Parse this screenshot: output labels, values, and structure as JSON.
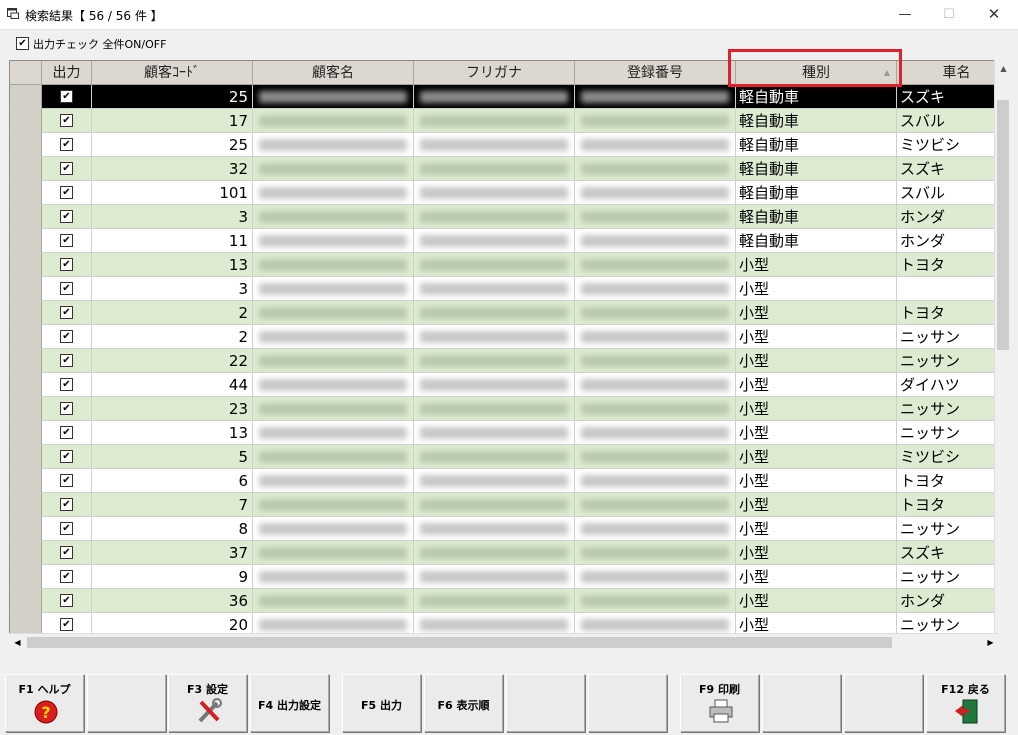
{
  "window": {
    "title": "検索結果【 56 / 56 件 】",
    "minimize": "—",
    "maximize": "☐",
    "close": "✕"
  },
  "select_all": {
    "label": "出力チェック 全件ON/OFF",
    "checked": true
  },
  "grid": {
    "columns": [
      "",
      "出力",
      "顧客ｺｰﾄﾞ",
      "顧客名",
      "フリガナ",
      "登録番号",
      "種別",
      "車名"
    ],
    "sorted_column": "種別",
    "sort_indicator": "▲",
    "rows": [
      {
        "check": "✔",
        "code": "25",
        "type": "軽自動車",
        "maker": "スズキ",
        "selected": true
      },
      {
        "check": "✔",
        "code": "17",
        "type": "軽自動車",
        "maker": "スバル"
      },
      {
        "check": "✔",
        "code": "25",
        "type": "軽自動車",
        "maker": "ミツビシ"
      },
      {
        "check": "✔",
        "code": "32",
        "type": "軽自動車",
        "maker": "スズキ"
      },
      {
        "check": "✔",
        "code": "101",
        "type": "軽自動車",
        "maker": "スバル"
      },
      {
        "check": "✔",
        "code": "3",
        "type": "軽自動車",
        "maker": "ホンダ"
      },
      {
        "check": "✔",
        "code": "11",
        "type": "軽自動車",
        "maker": "ホンダ"
      },
      {
        "check": "✔",
        "code": "13",
        "type": "小型",
        "maker": "トヨタ"
      },
      {
        "check": "✔",
        "code": "3",
        "type": "小型",
        "maker": ""
      },
      {
        "check": "✔",
        "code": "2",
        "type": "小型",
        "maker": "トヨタ"
      },
      {
        "check": "✔",
        "code": "2",
        "type": "小型",
        "maker": "ニッサン"
      },
      {
        "check": "✔",
        "code": "22",
        "type": "小型",
        "maker": "ニッサン"
      },
      {
        "check": "✔",
        "code": "44",
        "type": "小型",
        "maker": "ダイハツ"
      },
      {
        "check": "✔",
        "code": "23",
        "type": "小型",
        "maker": "ニッサン"
      },
      {
        "check": "✔",
        "code": "13",
        "type": "小型",
        "maker": "ニッサン"
      },
      {
        "check": "✔",
        "code": "5",
        "type": "小型",
        "maker": "ミツビシ"
      },
      {
        "check": "✔",
        "code": "6",
        "type": "小型",
        "maker": "トヨタ"
      },
      {
        "check": "✔",
        "code": "7",
        "type": "小型",
        "maker": "トヨタ"
      },
      {
        "check": "✔",
        "code": "8",
        "type": "小型",
        "maker": "ニッサン"
      },
      {
        "check": "✔",
        "code": "37",
        "type": "小型",
        "maker": "スズキ"
      },
      {
        "check": "✔",
        "code": "9",
        "type": "小型",
        "maker": "ニッサン"
      },
      {
        "check": "✔",
        "code": "36",
        "type": "小型",
        "maker": "ホンダ"
      },
      {
        "check": "✔",
        "code": "20",
        "type": "小型",
        "maker": "ニッサン"
      }
    ]
  },
  "scroll_arrows": {
    "up": "▲",
    "down": "▼",
    "left": "◀",
    "right": "▶"
  },
  "function_keys": [
    {
      "name": "f1",
      "label": "F1 ヘルプ",
      "icon": "help-icon"
    },
    {
      "name": "f2",
      "label": ""
    },
    {
      "name": "f3",
      "label": "F3 設定",
      "icon": "tools-icon"
    },
    {
      "name": "f4",
      "label": "F4 出力設定"
    },
    {
      "name": "f5",
      "label": "F5 出力"
    },
    {
      "name": "f6",
      "label": "F6 表示順"
    },
    {
      "name": "f7",
      "label": ""
    },
    {
      "name": "f8",
      "label": ""
    },
    {
      "name": "f9",
      "label": "F9 印刷",
      "icon": "printer-icon"
    },
    {
      "name": "f10",
      "label": ""
    },
    {
      "name": "f11",
      "label": ""
    },
    {
      "name": "f12",
      "label": "F12 戻る",
      "icon": "exit-door-icon"
    }
  ],
  "colors": {
    "row_alt": "#ddecd0",
    "row_selected": "#000000",
    "header": "#dcd8d0",
    "highlight": "#e0202a"
  }
}
